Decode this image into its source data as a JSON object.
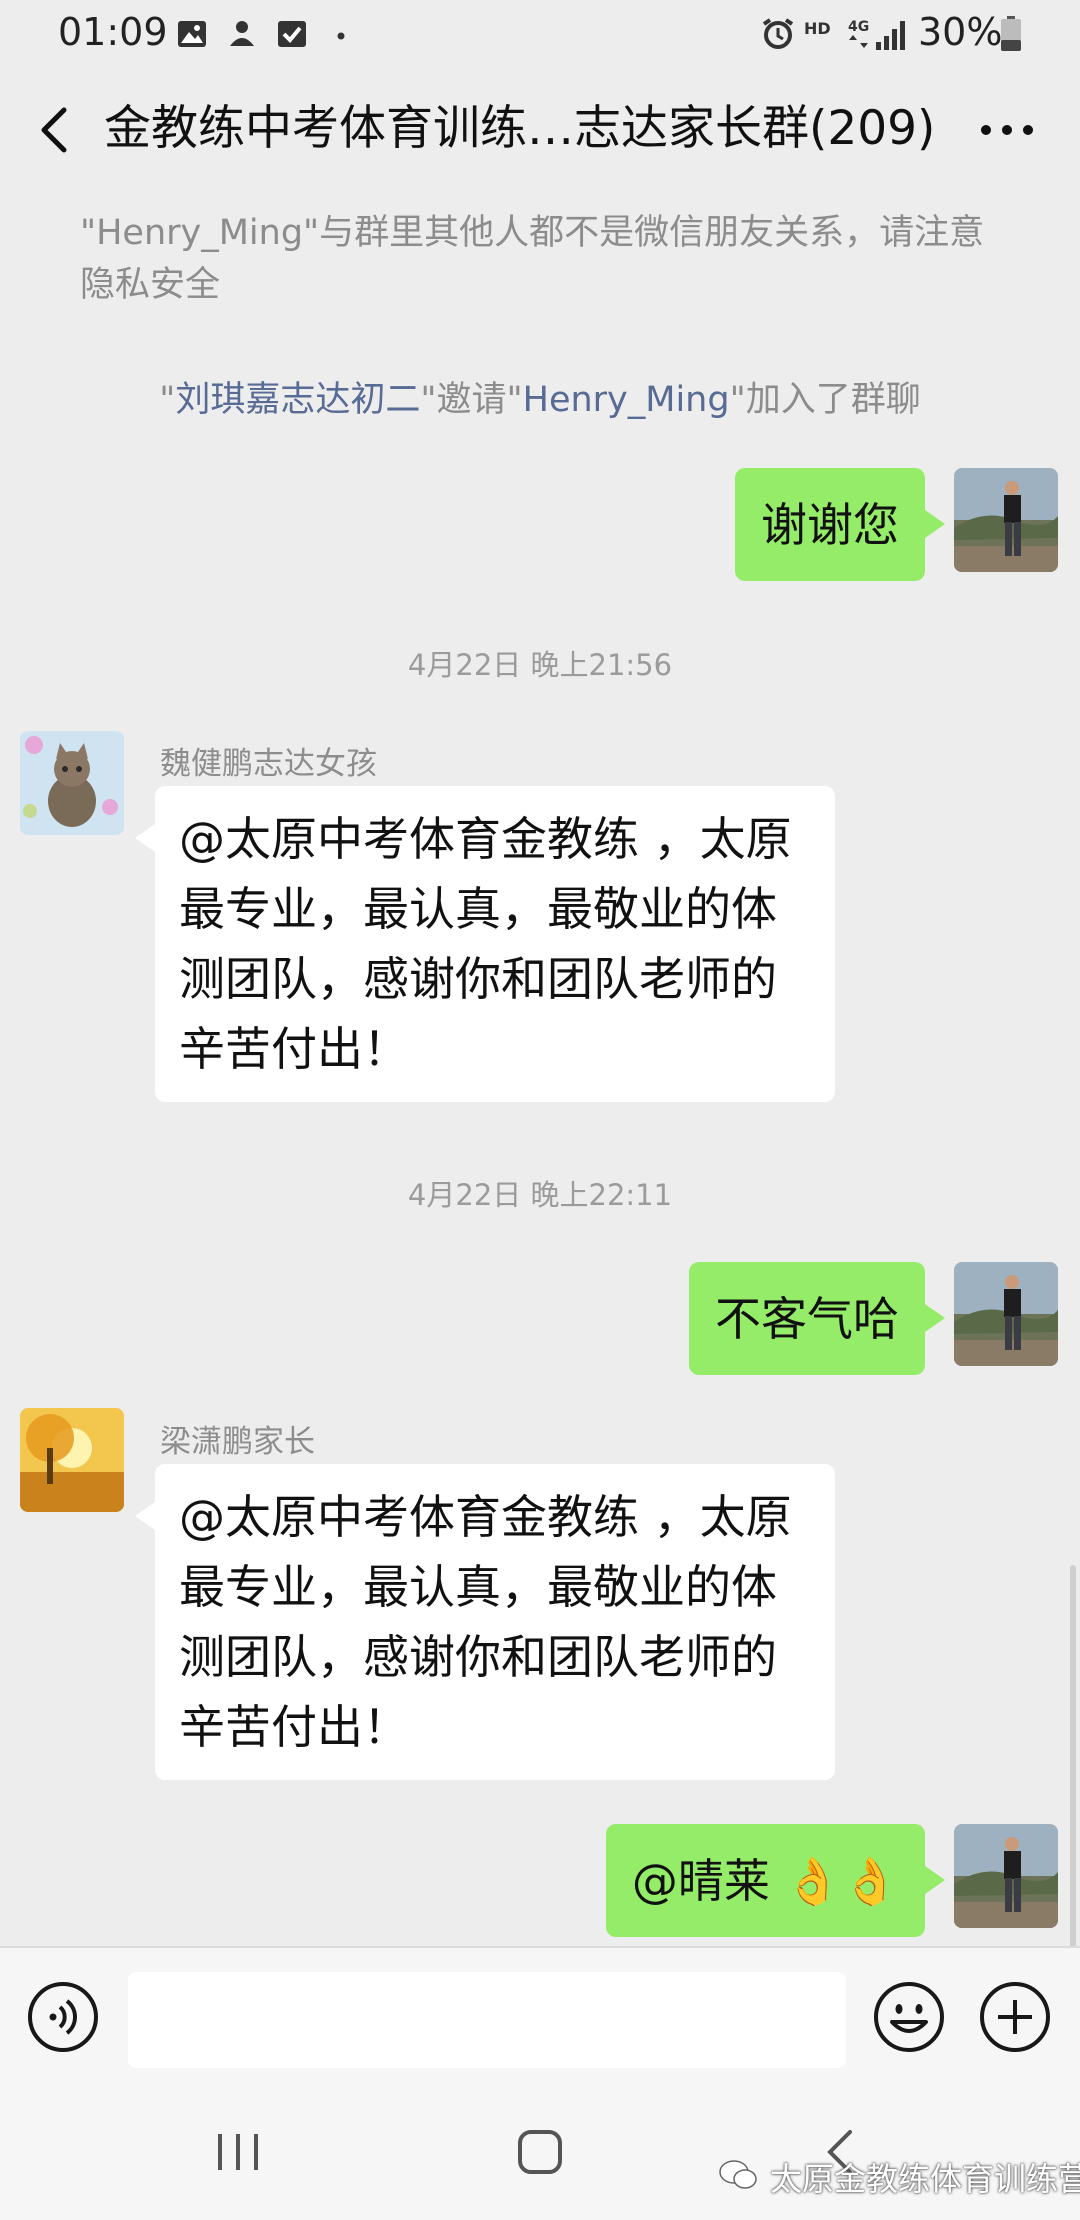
{
  "status_bar": {
    "time": "01:09",
    "battery": "30%",
    "icons": [
      "image-icon",
      "tv-icon",
      "check-icon",
      "dot-icon",
      "alarm-icon",
      "hd-icon",
      "4g-signal-icon",
      "battery-icon"
    ]
  },
  "header": {
    "title": "金教练中考体育训练…志达家长群(209)"
  },
  "notices": {
    "privacy": "\"Henry_Ming\"与群里其他人都不是微信朋友关系，请注意隐私安全",
    "invite_prefix": "\"",
    "invite_inviter": "刘琪嘉志达初二",
    "invite_mid": "\"邀请\"",
    "invite_invitee": "Henry_Ming",
    "invite_suffix": "\"加入了群聊"
  },
  "messages": {
    "m1": {
      "text": "谢谢您"
    },
    "ts1": "4月22日 晚上21:56",
    "m2": {
      "sender": "魏健鹏志达女孩",
      "text": "@太原中考体育金教练 ，太原最专业，最认真，最敬业的体测团队，感谢你和团队老师的辛苦付出！"
    },
    "ts2": "4月22日 晚上22:11",
    "m3": {
      "text": "不客气哈"
    },
    "m4": {
      "sender": "梁潇鹏家长",
      "text": "@太原中考体育金教练 ，太原最专业，最认真，最敬业的体测团队，感谢你和团队老师的辛苦付出！"
    },
    "m5": {
      "text": "@晴莱  👌👌"
    }
  },
  "watermark": "太原金教练体育训练营",
  "colors": {
    "background": "#ededed",
    "outgoing_bubble": "#95ec69",
    "incoming_bubble": "#ffffff",
    "name_link": "#576b95"
  }
}
